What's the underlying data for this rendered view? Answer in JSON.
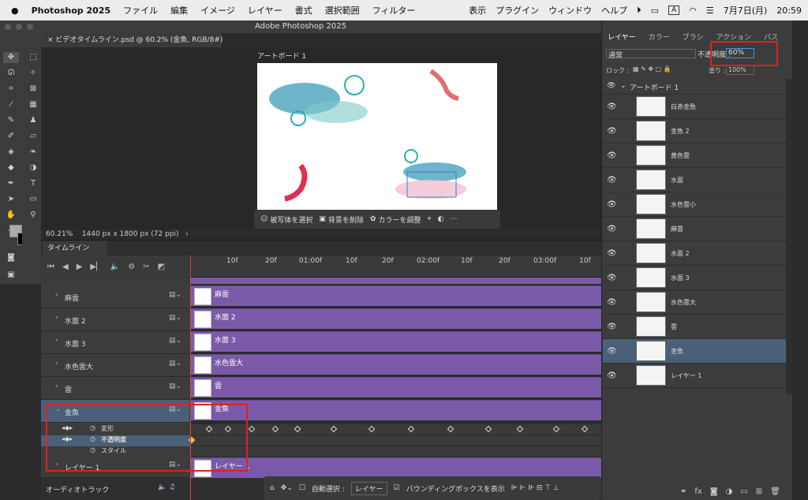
{
  "menubar": {
    "app": "Photoshop 2025",
    "items": [
      "ファイル",
      "編集",
      "イメージ",
      "レイヤー",
      "書式",
      "選択範囲",
      "フィルター",
      "表示",
      "プラグイン",
      "ウィンドウ",
      "ヘルプ"
    ],
    "date": "7月7日(月)",
    "time": "20:59",
    "input": "A"
  },
  "window": {
    "title": "Adobe Photoshop 2025",
    "doc_tab": "ビデオタイムライン.psd @ 60.2% (金魚, RGB/8#) *"
  },
  "canvas": {
    "artboard_label": "アートボード 1",
    "ctx_select": "被写体を選択",
    "ctx_remove_bg": "背景を削除",
    "ctx_color": "カラーを調整"
  },
  "status": {
    "zoom": "60.21%",
    "size": "1440 px x 1800 px (72 ppi)"
  },
  "timeline": {
    "tab": "タイムライン",
    "ruler": [
      "10f",
      "20f",
      "01:00f",
      "10f",
      "20f",
      "02:00f",
      "10f",
      "20f",
      "03:00f",
      "10f"
    ],
    "layers": [
      {
        "name": "麻雲"
      },
      {
        "name": "水面 2"
      },
      {
        "name": "水面 3"
      },
      {
        "name": "水色雲大"
      },
      {
        "name": "雲"
      },
      {
        "name": "金魚"
      },
      {
        "name": "レイヤー 1"
      }
    ],
    "props": [
      "変形",
      "不透明度",
      "スタイル"
    ],
    "audio": "オーディオトラック"
  },
  "floatbar": {
    "auto_select": "自動選択 :",
    "target": "レイヤー",
    "bbox": "バウンディングボックスを表示"
  },
  "panel": {
    "tabs": [
      "レイヤー",
      "カラー",
      "ブラシ",
      "アクション",
      "パス"
    ],
    "blend": "通常",
    "opacity_label": "不透明度 :",
    "opacity": "60%",
    "lock_label": "ロック :",
    "fill_label": "塗り :",
    "fill": "100%",
    "group": "アートボード 1",
    "layers": [
      "白赤金魚",
      "金魚 2",
      "黄色雲",
      "水面",
      "水色雲小",
      "麻雲",
      "水面 2",
      "水面 3",
      "水色雲大",
      "雲",
      "金魚",
      "レイヤー 1"
    ],
    "selected": "金魚"
  },
  "colors": {
    "track": "#7a5aa8",
    "selected": "#4a6078",
    "highlight": "#e02020"
  }
}
